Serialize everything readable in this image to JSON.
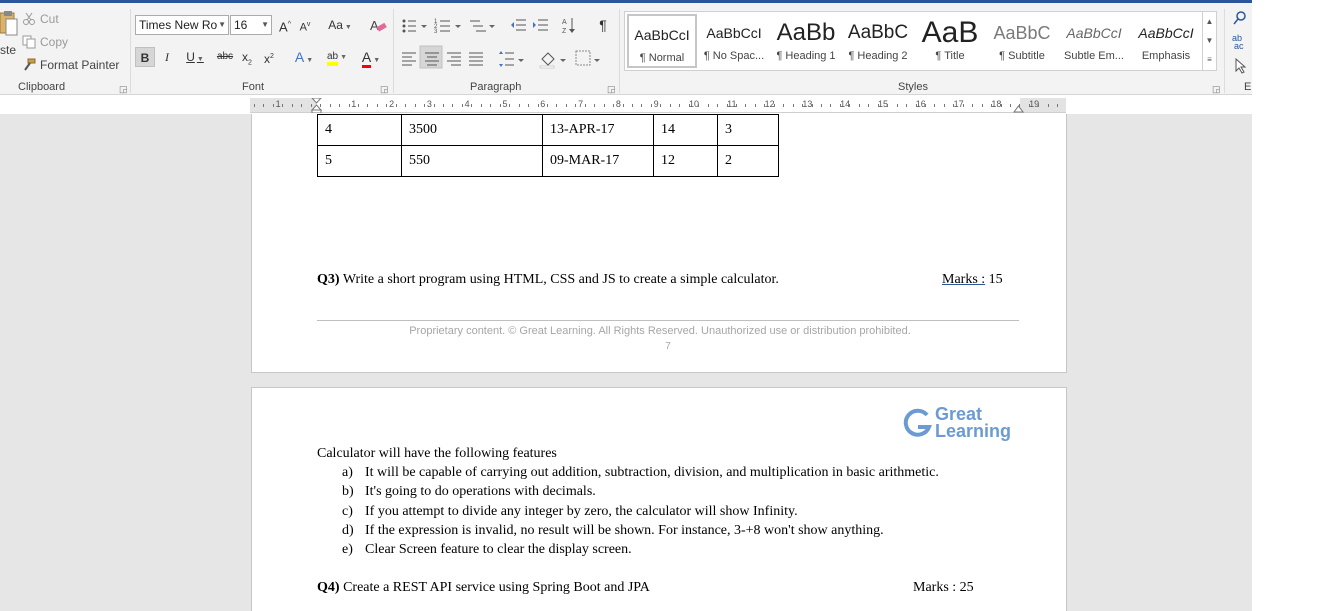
{
  "ribbon": {
    "clipboard": {
      "paste_fragment": "ste",
      "cut": "Cut",
      "copy": "Copy",
      "format_painter": "Format Painter",
      "label": "Clipboard"
    },
    "font": {
      "font_name": "Times New Ro",
      "font_size": "16",
      "grow": "A",
      "shrink": "A",
      "change_case": "Aa",
      "bold": "B",
      "italic": "I",
      "underline": "U",
      "strike": "abc",
      "subscript": "x",
      "superscript": "x",
      "effects": "A",
      "highlight": "ab",
      "font_color": "A",
      "label": "Font",
      "highlight_color": "#ffff00",
      "font_color_value": "#ff0000"
    },
    "paragraph": {
      "pilcrow": "¶",
      "label": "Paragraph"
    },
    "styles": {
      "label": "Styles",
      "items": [
        {
          "preview": "AaBbCcI",
          "name": "¶ Normal"
        },
        {
          "preview": "AaBbCcI",
          "name": "¶ No Spac..."
        },
        {
          "preview": "AaBb",
          "name": "¶ Heading 1"
        },
        {
          "preview": "AaBbC",
          "name": "¶ Heading 2"
        },
        {
          "preview": "AaB",
          "name": "¶ Title"
        },
        {
          "preview": "AaBbC",
          "name": "¶ Subtitle"
        },
        {
          "preview": "AaBbCcI",
          "name": "Subtle Em..."
        },
        {
          "preview": "AaBbCcI",
          "name": "Emphasis"
        }
      ]
    },
    "editing": {
      "fragment": "E"
    }
  },
  "ruler": {
    "numbers": [
      "1",
      "1",
      "2",
      "3",
      "4",
      "5",
      "6",
      "7",
      "8",
      "9",
      "10",
      "11",
      "12",
      "13",
      "14",
      "15",
      "16",
      "17",
      "18",
      "19"
    ]
  },
  "table": {
    "rows": [
      [
        "4",
        "3500",
        "13-APR-17",
        "14",
        "3"
      ],
      [
        "5",
        "550",
        "09-MAR-17",
        "12",
        "2"
      ]
    ]
  },
  "q3": {
    "label": "Q3)",
    "text": "Write a short program using HTML, CSS and JS to create a simple calculator.",
    "marks_label": "Marks :",
    "marks_value": "15"
  },
  "footer": {
    "text": "Proprietary content. © Great Learning. All Rights Reserved. Unauthorized use or distribution prohibited.",
    "page_number": "7"
  },
  "logo": {
    "line1": "Great",
    "line2": "Learning"
  },
  "calculator": {
    "intro": "Calculator will have the following features",
    "features": [
      {
        "letter": "a)",
        "text": "It will be capable of carrying out addition, subtraction, division, and multiplication in basic arithmetic."
      },
      {
        "letter": "b)",
        "text": "It's going to do operations with decimals."
      },
      {
        "letter": "c)",
        "text": "If you attempt to divide any integer by zero, the calculator will show Infinity."
      },
      {
        "letter": "d)",
        "text": "If the expression is invalid, no result will be shown. For instance, 3-+8 won't show anything."
      },
      {
        "letter": "e)",
        "text": "Clear Screen feature to clear the display screen."
      }
    ]
  },
  "q4": {
    "label": "Q4)",
    "text": "Create a REST API service using Spring Boot and JPA",
    "marks": "Marks : 25"
  },
  "colors": {
    "accent": "#2b579a",
    "logo": "#6b9bd2"
  }
}
